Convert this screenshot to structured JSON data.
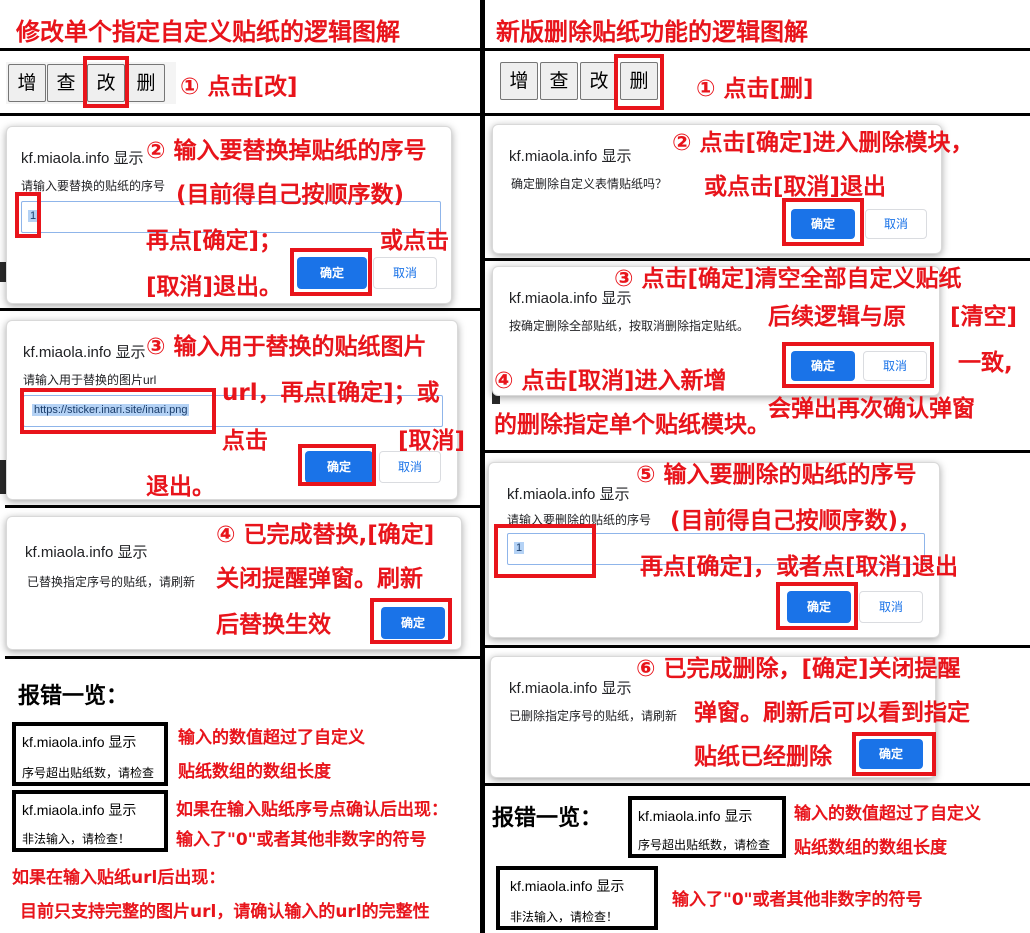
{
  "left": {
    "title": "修改单个指定自定义贴纸的逻辑图解",
    "toolbar": [
      "增",
      "查",
      "改",
      "删"
    ],
    "step1": "① 点击[改]",
    "dialog1": {
      "title": "kf.miaola.info 显示",
      "message": "请输入要替换的贴纸的序号",
      "value": "1",
      "ok": "确定",
      "cancel": "取消"
    },
    "note2": [
      "② 输入要替换掉贴纸的序号",
      "(目前得自己按顺序数)",
      "再点[确定]；",
      "或点击",
      "[取消]退出。"
    ],
    "dialog2": {
      "title": "kf.miaola.info 显示",
      "message": "请输入用于替换的图片url",
      "value": "https://sticker.inari.site/inari.png",
      "ok": "确定",
      "cancel": "取消"
    },
    "note3": [
      "③ 输入用于替换的贴纸图片",
      "url，再点[确定]；或",
      "点击",
      "[取消]",
      "退出。"
    ],
    "dialog3": {
      "title": "kf.miaola.info 显示",
      "message": "已替换指定序号的贴纸，请刷新",
      "ok": "确定"
    },
    "note4": [
      "④ 已完成替换,[确定]",
      "关闭提醒弹窗。刷新",
      "后替换生效"
    ],
    "errors_title": "报错一览：",
    "err1": {
      "title": "kf.miaola.info 显示",
      "message": "序号超出贴纸数，请检查",
      "note": [
        "输入的数值超过了自定义",
        "贴纸数组的数组长度"
      ]
    },
    "err2": {
      "title": "kf.miaola.info 显示",
      "message": "非法输入，请检查！",
      "note": [
        "如果在输入贴纸序号点确认后出现：",
        "输入了\"0\"或者其他非数字的符号"
      ]
    },
    "err3_note": [
      "如果在输入贴纸url后出现：",
      "目前只支持完整的图片url，请确认输入的url的完整性"
    ]
  },
  "right": {
    "title": "新版删除贴纸功能的逻辑图解",
    "toolbar": [
      "增",
      "查",
      "改",
      "删"
    ],
    "step1": "① 点击[删]",
    "dialog1": {
      "title": "kf.miaola.info 显示",
      "message": "确定删除自定义表情贴纸吗？",
      "ok": "确定",
      "cancel": "取消"
    },
    "note2": [
      "② 点击[确定]进入删除模块，",
      "或点击[取消]退出"
    ],
    "dialog2": {
      "title": "kf.miaola.info 显示",
      "message": "按确定删除全部贴纸，按取消删除指定贴纸。",
      "ok": "确定",
      "cancel": "取消"
    },
    "note3": [
      "③ 点击[确定]清空全部自定义贴纸",
      "后续逻辑与原",
      "[清空]",
      "一致,",
      "会弹出再次确认弹窗"
    ],
    "note4": [
      "④ 点击[取消]进入新增",
      "的删除指定单个贴纸模块。"
    ],
    "dialog3": {
      "title": "kf.miaola.info 显示",
      "message": "请输入要删除的贴纸的序号",
      "value": "1",
      "ok": "确定",
      "cancel": "取消"
    },
    "note5": [
      "⑤ 输入要删除的贴纸的序号",
      "(目前得自己按顺序数)，",
      "再点[确定]，或者点[取消]退出"
    ],
    "dialog4": {
      "title": "kf.miaola.info 显示",
      "message": "已删除指定序号的贴纸，请刷新",
      "ok": "确定"
    },
    "note6": [
      "⑥ 已完成删除，[确定]关闭提醒",
      "弹窗。刷新后可以看到指定",
      "贴纸已经删除"
    ],
    "errors_title": "报错一览：",
    "err1": {
      "title": "kf.miaola.info 显示",
      "message": "序号超出贴纸数，请检查",
      "note": [
        "输入的数值超过了自定义",
        "贴纸数组的数组长度"
      ]
    },
    "err2": {
      "title": "kf.miaola.info 显示",
      "message": "非法输入，请检查！",
      "note": "输入了\"0\"或者其他非数字的符号"
    }
  },
  "colors": {
    "accent": "#e8141b",
    "button": "#1a73e8"
  }
}
